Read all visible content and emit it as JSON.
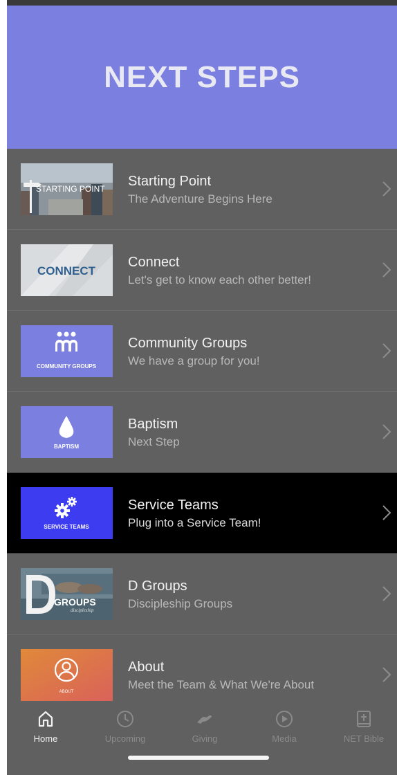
{
  "header": {
    "title": "NEXT STEPS"
  },
  "thumbnails": {
    "starting_point": "STARTING POINT",
    "connect": "CONNECT",
    "community_groups": "COMMUNITY GROUPS",
    "baptism": "BAPTISM",
    "service_teams": "SERVICE TEAMS",
    "dgroups": "GROUPS",
    "dgroups_script": "discipleship",
    "about": "ABOUT"
  },
  "items": [
    {
      "title": "Starting Point",
      "subtitle": "The Adventure Begins Here"
    },
    {
      "title": "Connect",
      "subtitle": "Let's get to know each other better!"
    },
    {
      "title": "Community Groups",
      "subtitle": "We have a group for you!"
    },
    {
      "title": "Baptism",
      "subtitle": "Next Step"
    },
    {
      "title": "Service Teams",
      "subtitle": "Plug into a Service Team!"
    },
    {
      "title": "D Groups",
      "subtitle": "Discipleship Groups"
    },
    {
      "title": "About",
      "subtitle": "Meet the Team & What We're About"
    }
  ],
  "tabs": [
    {
      "label": "Home",
      "icon": "home-icon"
    },
    {
      "label": "Upcoming",
      "icon": "clock-icon"
    },
    {
      "label": "Giving",
      "icon": "giving-hand-icon"
    },
    {
      "label": "Media",
      "icon": "play-circle-icon"
    },
    {
      "label": "NET Bible",
      "icon": "bible-icon"
    }
  ],
  "colors": {
    "header_bg": "#7b7fe0",
    "list_bg": "#606060",
    "active_row_bg": "#000000",
    "service_teams_thumb": "#3d3cf0"
  }
}
